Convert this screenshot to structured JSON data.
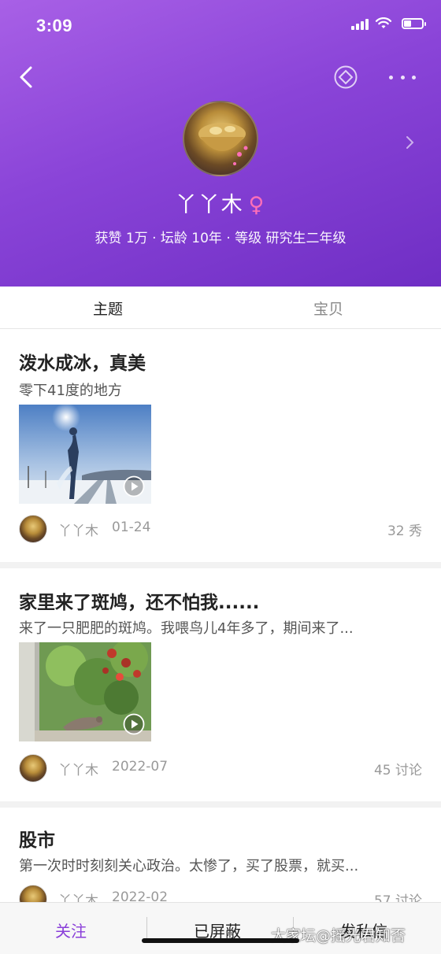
{
  "status_bar": {
    "time": "3:09"
  },
  "profile": {
    "username": "丫丫木",
    "gender_symbol": "♀",
    "stats": "获赞 1万 · 坛龄 10年 · 等级 研究生二年级"
  },
  "tabs": [
    {
      "label": "主题",
      "active": true
    },
    {
      "label": "宝贝",
      "active": false
    }
  ],
  "posts": [
    {
      "title": "泼水成冰，真美",
      "summary": "零下41度的地方",
      "author": "丫丫木",
      "date": "01-24",
      "count": "32 秀"
    },
    {
      "title": "家里来了斑鸠，还不怕我......",
      "summary": "来了一只肥肥的斑鸠。我喂鸟儿4年多了，期间来了...",
      "author": "丫丫木",
      "date": "2022-07",
      "count": "45 讨论"
    },
    {
      "title": "股市",
      "summary": "第一次时时刻刻关心政治。太惨了，买了股票，就买...",
      "author": "丫丫木",
      "date": "2022-02",
      "count": "57 讨论"
    }
  ],
  "bottom_bar": {
    "follow": "关注",
    "blocked": "已屏蔽",
    "message": "发私信"
  },
  "watermark": "大家坛@摇光君知否",
  "colors": {
    "header_purple": "#8a44d8",
    "accent": "#8a3fd9",
    "gender_pink": "#ff6fb8"
  }
}
